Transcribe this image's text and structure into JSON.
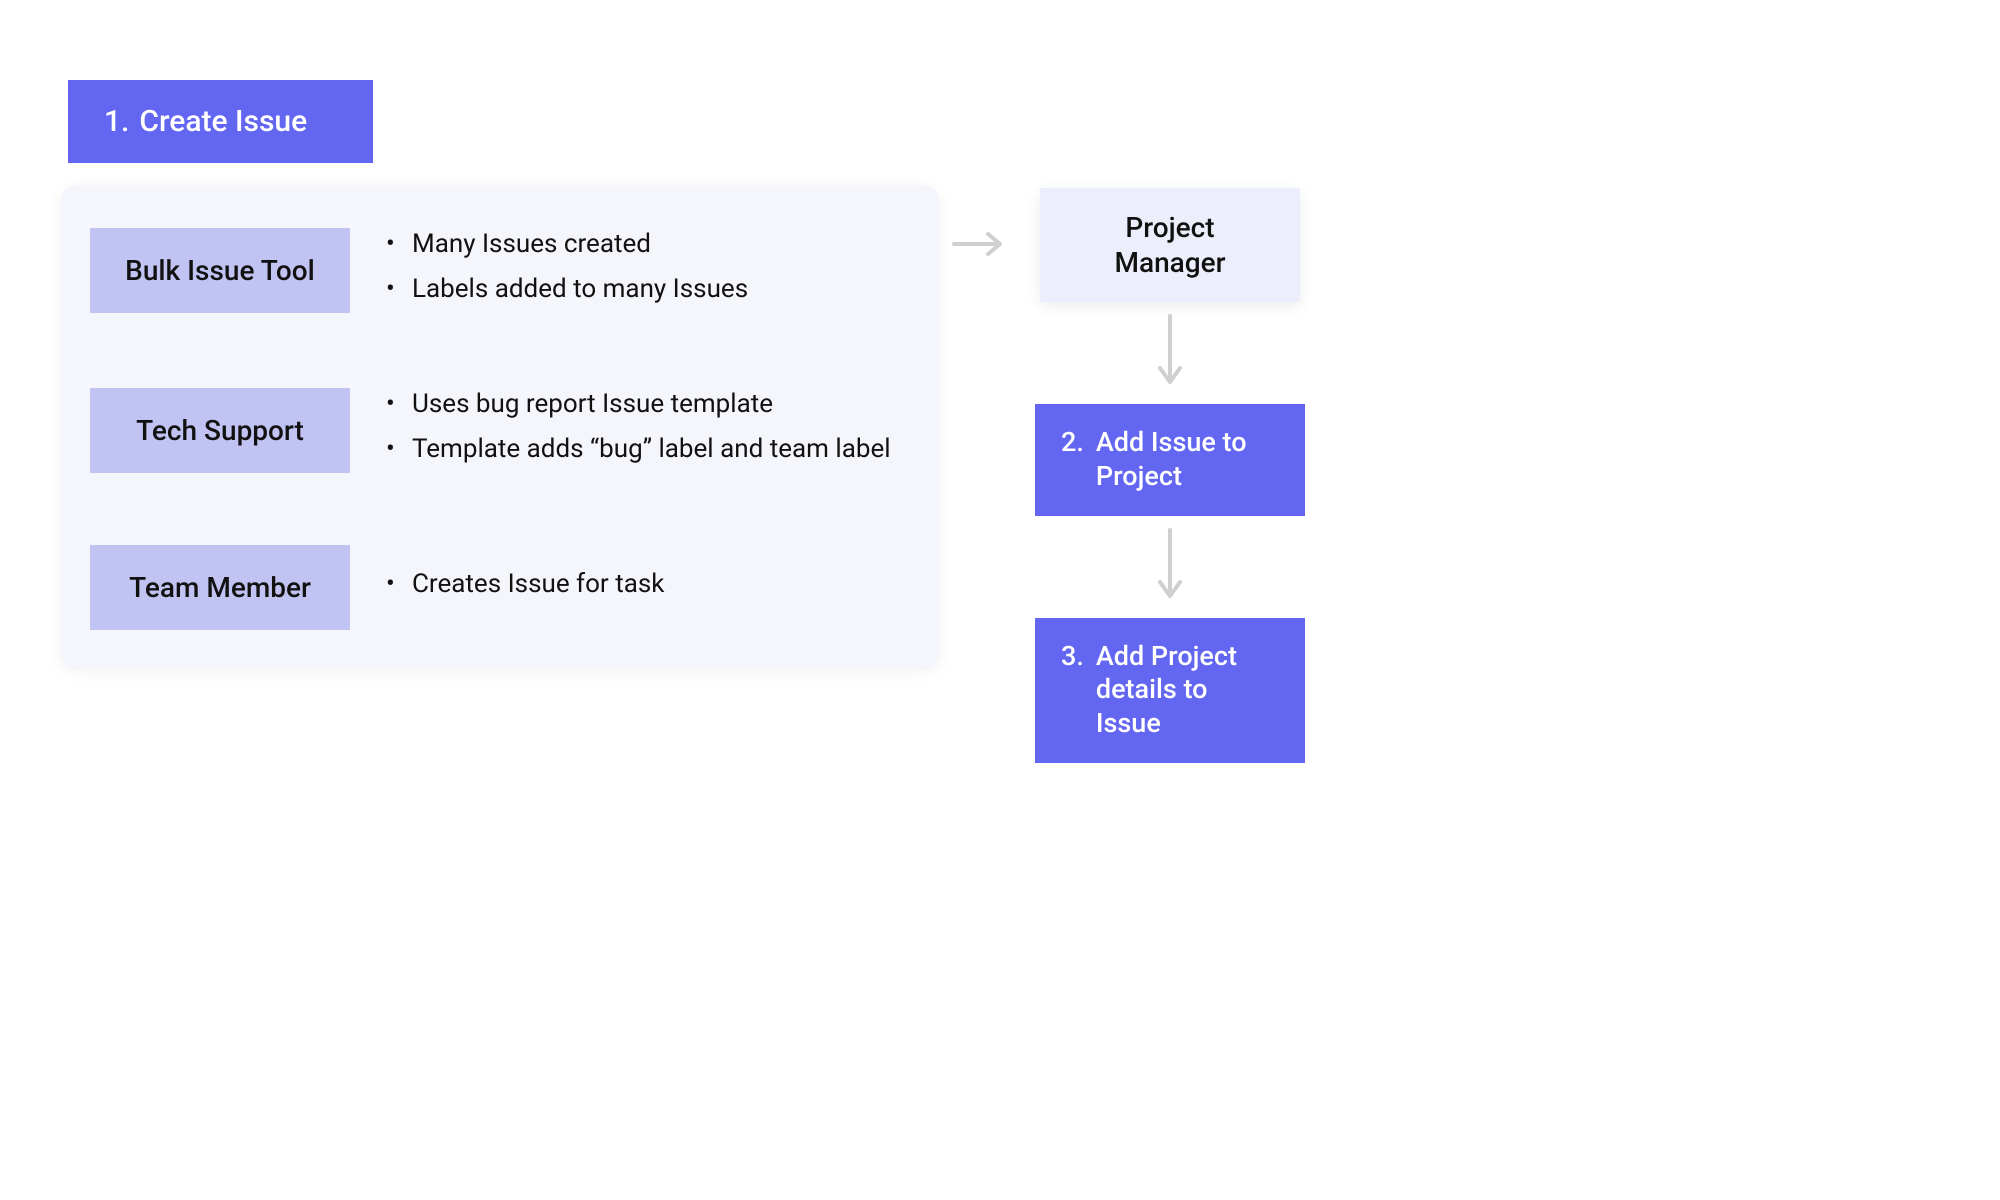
{
  "colors": {
    "primary": "#6366F1",
    "actor": "#C1C3F2",
    "panel": "#F5F6FB",
    "pm_box": "#EDEEFB",
    "arrow": "#CFCFCF"
  },
  "header": {
    "number": "1.",
    "label": "Create Issue"
  },
  "actors": [
    {
      "name": "Bulk Issue Tool",
      "bullets": [
        "Many Issues created",
        "Labels added to many Issues"
      ]
    },
    {
      "name": "Tech Support",
      "bullets": [
        "Uses bug report Issue template",
        "Template adds “bug” label and team label"
      ]
    },
    {
      "name": "Team Member",
      "bullets": [
        "Creates Issue for task"
      ]
    }
  ],
  "right": {
    "receiver": "Project Manager",
    "steps": [
      {
        "number": "2.",
        "text": "Add Issue to Project"
      },
      {
        "number": "3.",
        "text": "Add Project details to Issue"
      }
    ]
  }
}
